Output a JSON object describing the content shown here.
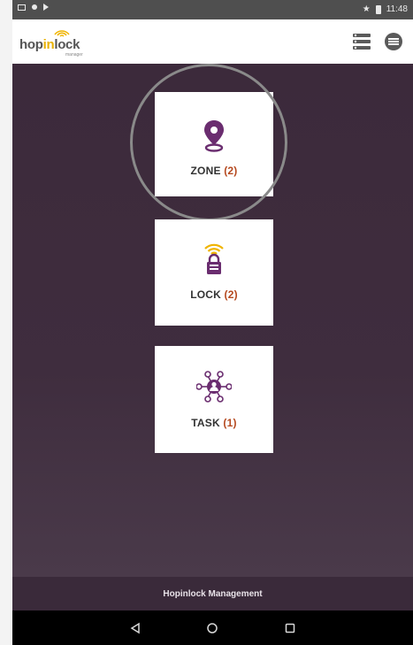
{
  "status_bar": {
    "time": "11:48"
  },
  "app_bar": {
    "logo_prefix": "hop",
    "logo_accent": "in",
    "logo_suffix": "lock",
    "logo_sub": "manager",
    "actions": [
      "list-icon",
      "menu-icon"
    ]
  },
  "tiles": [
    {
      "label": "ZONE",
      "count": "(2)",
      "icon": "location-pin-icon"
    },
    {
      "label": "LOCK",
      "count": "(2)",
      "icon": "wireless-lock-icon"
    },
    {
      "label": "TASK",
      "count": "(1)",
      "icon": "network-person-icon"
    }
  ],
  "footer": {
    "text": "Hopinlock Management"
  },
  "nav": [
    "back-icon",
    "home-icon",
    "recents-icon"
  ],
  "colors": {
    "primary_purple": "#6a2d6f",
    "accent_yellow": "#f0b400",
    "count_red": "#b5491f",
    "background": "#3e2c3d"
  }
}
